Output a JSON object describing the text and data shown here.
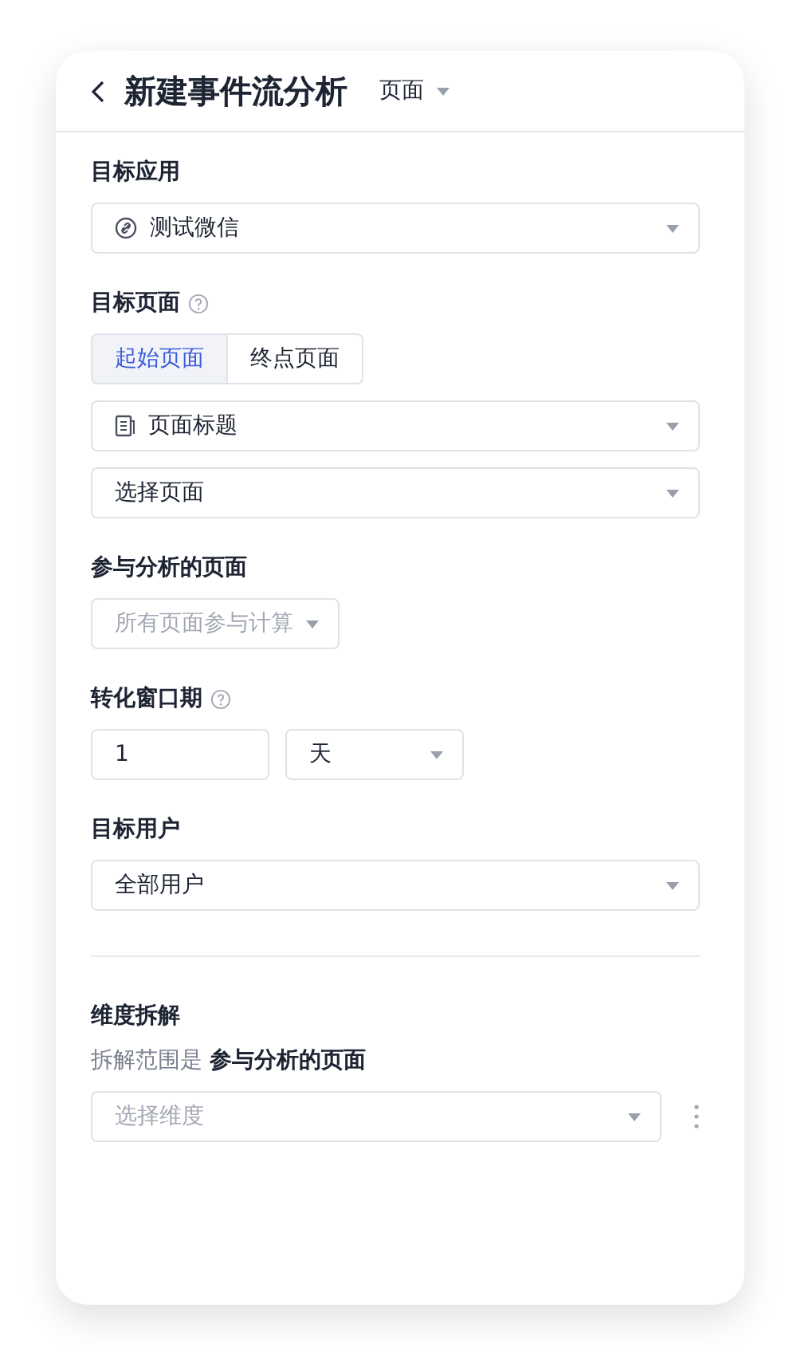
{
  "header": {
    "title": "新建事件流分析",
    "type_selector": "页面"
  },
  "sections": [
    {
      "kind": "select",
      "label": "目标应用",
      "help": false,
      "fields": [
        {
          "kind": "app",
          "value": "测试微信"
        }
      ]
    },
    {
      "kind": "select",
      "label": "目标页面",
      "help": true,
      "tabs": [
        {
          "label": "起始页面",
          "selected": true
        },
        {
          "label": "终点页面",
          "selected": false
        }
      ],
      "fields": [
        {
          "kind": "attribute",
          "value": "页面标题"
        },
        {
          "kind": "plain",
          "value": "选择页面"
        }
      ]
    },
    {
      "kind": "compact",
      "label": "参与分析的页面",
      "help": false,
      "fields": [
        {
          "kind": "plain",
          "placeholder": "所有页面参与计算"
        }
      ]
    },
    {
      "kind": "window",
      "label": "转化窗口期",
      "help": true,
      "number": "1",
      "unit": "天"
    },
    {
      "kind": "select",
      "label": "目标用户",
      "help": false,
      "fields": [
        {
          "kind": "plain",
          "value": "全部用户"
        }
      ]
    },
    {
      "kind": "divider"
    },
    {
      "kind": "breakdown",
      "label": "维度拆解",
      "help": false,
      "note": "拆解范围是 **参与分析的页面**",
      "fields": [
        {
          "kind": "plain",
          "placeholder": "选择维度"
        }
      ]
    }
  ]
}
